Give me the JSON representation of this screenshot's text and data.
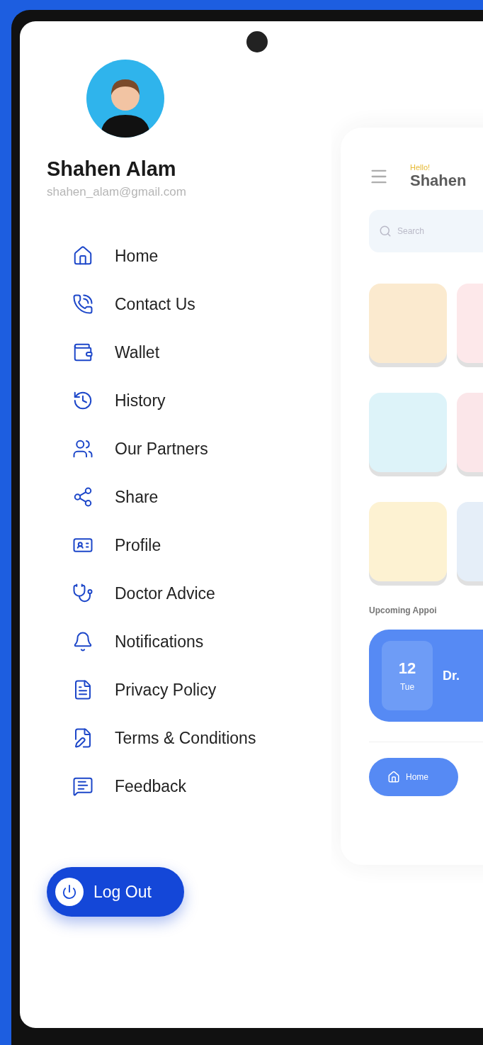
{
  "drawer": {
    "user": {
      "name": "Shahen Alam",
      "email": "shahen_alam@gmail.com"
    },
    "menu": [
      {
        "label": "Home"
      },
      {
        "label": "Contact Us"
      },
      {
        "label": "Wallet"
      },
      {
        "label": "History"
      },
      {
        "label": "Our Partners"
      },
      {
        "label": "Share"
      },
      {
        "label": "Profile"
      },
      {
        "label": "Doctor Advice"
      },
      {
        "label": "Notifications"
      },
      {
        "label": "Privacy Policy"
      },
      {
        "label": "Terms & Conditions"
      },
      {
        "label": "Feedback"
      }
    ],
    "logout": "Log Out"
  },
  "home_preview": {
    "greeting": "Hello!",
    "name": "Shahen",
    "search": {
      "placeholder": "Search"
    },
    "tiles": [
      {
        "color": "#fbe6c4"
      },
      {
        "color": "#fde3e6"
      },
      {
        "color": "#d5f1f8"
      },
      {
        "color": "#fbe1e4"
      },
      {
        "color": "#fdf0c8"
      },
      {
        "color": "#dfeaf7"
      }
    ],
    "section_title": "Upcoming Appoi",
    "appointment": {
      "day": "12",
      "weekday": "Tue",
      "doctor": "Dr."
    },
    "nav": {
      "home": "Home"
    }
  }
}
